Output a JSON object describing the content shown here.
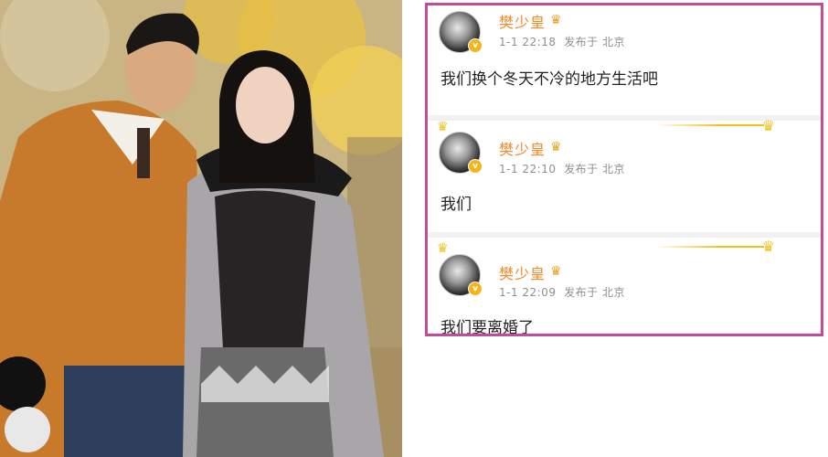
{
  "posts": [
    {
      "username": "樊少皇",
      "time": "1-1 22:18",
      "source": "发布于 北京",
      "text": "我们换个冬天不冷的地方生活吧"
    },
    {
      "username": "樊少皇",
      "time": "1-1 22:10",
      "source": "发布于 北京",
      "text": "我们"
    },
    {
      "username": "樊少皇",
      "time": "1-1 22:09",
      "source": "发布于 北京",
      "text": "我们要离婚了"
    }
  ],
  "colors": {
    "highlight_border": "#c64a9a",
    "username": "#f08a2a",
    "verified_badge": "#f2b51b"
  },
  "icons": [
    "vip-crown-icon",
    "verified-v-icon",
    "crown-decoration-icon"
  ]
}
